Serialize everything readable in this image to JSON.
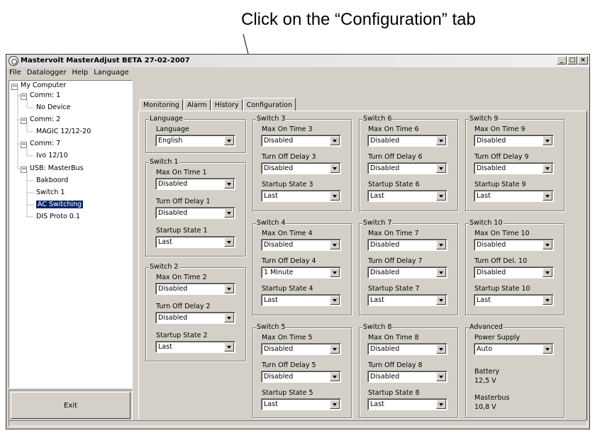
{
  "callout": "Click on the “Configuration” tab",
  "window": {
    "title": "Mastervolt MasterAdjust BETA 27-02-2007",
    "buttons": {
      "minimize": "_",
      "maximize": "□",
      "close": "×"
    }
  },
  "menu": [
    "File",
    "Datalogger",
    "Help",
    "Language"
  ],
  "tree": {
    "root": "My Computer",
    "comm1": "Comm: 1",
    "comm1_dev": "No Device",
    "comm2": "Comm: 2",
    "comm2_dev": "MAGIC 12/12-20",
    "comm7": "Comm: 7",
    "comm7_dev": "Ivo 12/10",
    "usb": "USB: MasterBus",
    "usb_dev1": "Bakboord",
    "usb_dev2": "Switch 1",
    "usb_dev3": "AC Switching",
    "usb_dev4": "DIS Proto 0.1",
    "expander_minus": "−"
  },
  "exit_label": "Exit",
  "tabs": [
    "Monitoring",
    "Alarm",
    "History",
    "Configuration"
  ],
  "groups": {
    "language": {
      "title": "Language",
      "label": "Language",
      "value": "English"
    },
    "switch1": {
      "title": "Switch 1",
      "fields": [
        {
          "label": "Max On Time 1",
          "value": "Disabled"
        },
        {
          "label": "Turn Off Delay 1",
          "value": "Disabled"
        },
        {
          "label": "Startup State 1",
          "value": "Last"
        }
      ]
    },
    "switch2": {
      "title": "Switch 2",
      "fields": [
        {
          "label": "Max On Time 2",
          "value": "Disabled"
        },
        {
          "label": "Turn Off Delay 2",
          "value": "Disabled"
        },
        {
          "label": "Startup State 2",
          "value": "Last"
        }
      ]
    },
    "switch3": {
      "title": "Switch 3",
      "fields": [
        {
          "label": "Max On Time 3",
          "value": "Disabled"
        },
        {
          "label": "Turn Off Delay 3",
          "value": "Disabled"
        },
        {
          "label": "Startup State 3",
          "value": "Last"
        }
      ]
    },
    "switch4": {
      "title": "Switch 4",
      "fields": [
        {
          "label": "Max On Time 4",
          "value": "Disabled"
        },
        {
          "label": "Turn Off Delay 4",
          "value": "1 Minute"
        },
        {
          "label": "Startup State 4",
          "value": "Last"
        }
      ]
    },
    "switch5": {
      "title": "Switch 5",
      "fields": [
        {
          "label": "Max On Time 5",
          "value": "Disabled"
        },
        {
          "label": "Turn Off Delay 5",
          "value": "Disabled"
        },
        {
          "label": "Startup State 5",
          "value": "Last"
        }
      ]
    },
    "switch6": {
      "title": "Switch 6",
      "fields": [
        {
          "label": "Max On Time 6",
          "value": "Disabled"
        },
        {
          "label": "Turn Off Delay 6",
          "value": "Disabled"
        },
        {
          "label": "Startup State 6",
          "value": "Last"
        }
      ]
    },
    "switch7": {
      "title": "Switch 7",
      "fields": [
        {
          "label": "Max On Time 7",
          "value": "Disabled"
        },
        {
          "label": "Turn Off Delay 7",
          "value": "Disabled"
        },
        {
          "label": "Startup State 7",
          "value": "Last"
        }
      ]
    },
    "switch8": {
      "title": "Switch 8",
      "fields": [
        {
          "label": "Max On Time 8",
          "value": "Disabled"
        },
        {
          "label": "Turn Off Delay 8",
          "value": "Disabled"
        },
        {
          "label": "Startup State 8",
          "value": "Last"
        }
      ]
    },
    "switch9": {
      "title": "Switch 9",
      "fields": [
        {
          "label": "Max On Time 9",
          "value": "Disabled"
        },
        {
          "label": "Turn Off Delay 9",
          "value": "Disabled"
        },
        {
          "label": "Startup State 9",
          "value": "Last"
        }
      ]
    },
    "switch10": {
      "title": "Switch 10",
      "fields": [
        {
          "label": "Max On Time 10",
          "value": "Disabled"
        },
        {
          "label": "Turn Off Del. 10",
          "value": "Disabled"
        },
        {
          "label": "Startup State 10",
          "value": "Last"
        }
      ]
    },
    "advanced": {
      "title": "Advanced",
      "power_label": "Power Supply",
      "power_value": "Auto",
      "battery_label": "Battery",
      "battery_value": "12,5 V",
      "masterbus_label": "Masterbus",
      "masterbus_value": "10,8 V"
    }
  },
  "colors": {
    "face": "#d4d0c8",
    "selection": "#0a246a"
  }
}
